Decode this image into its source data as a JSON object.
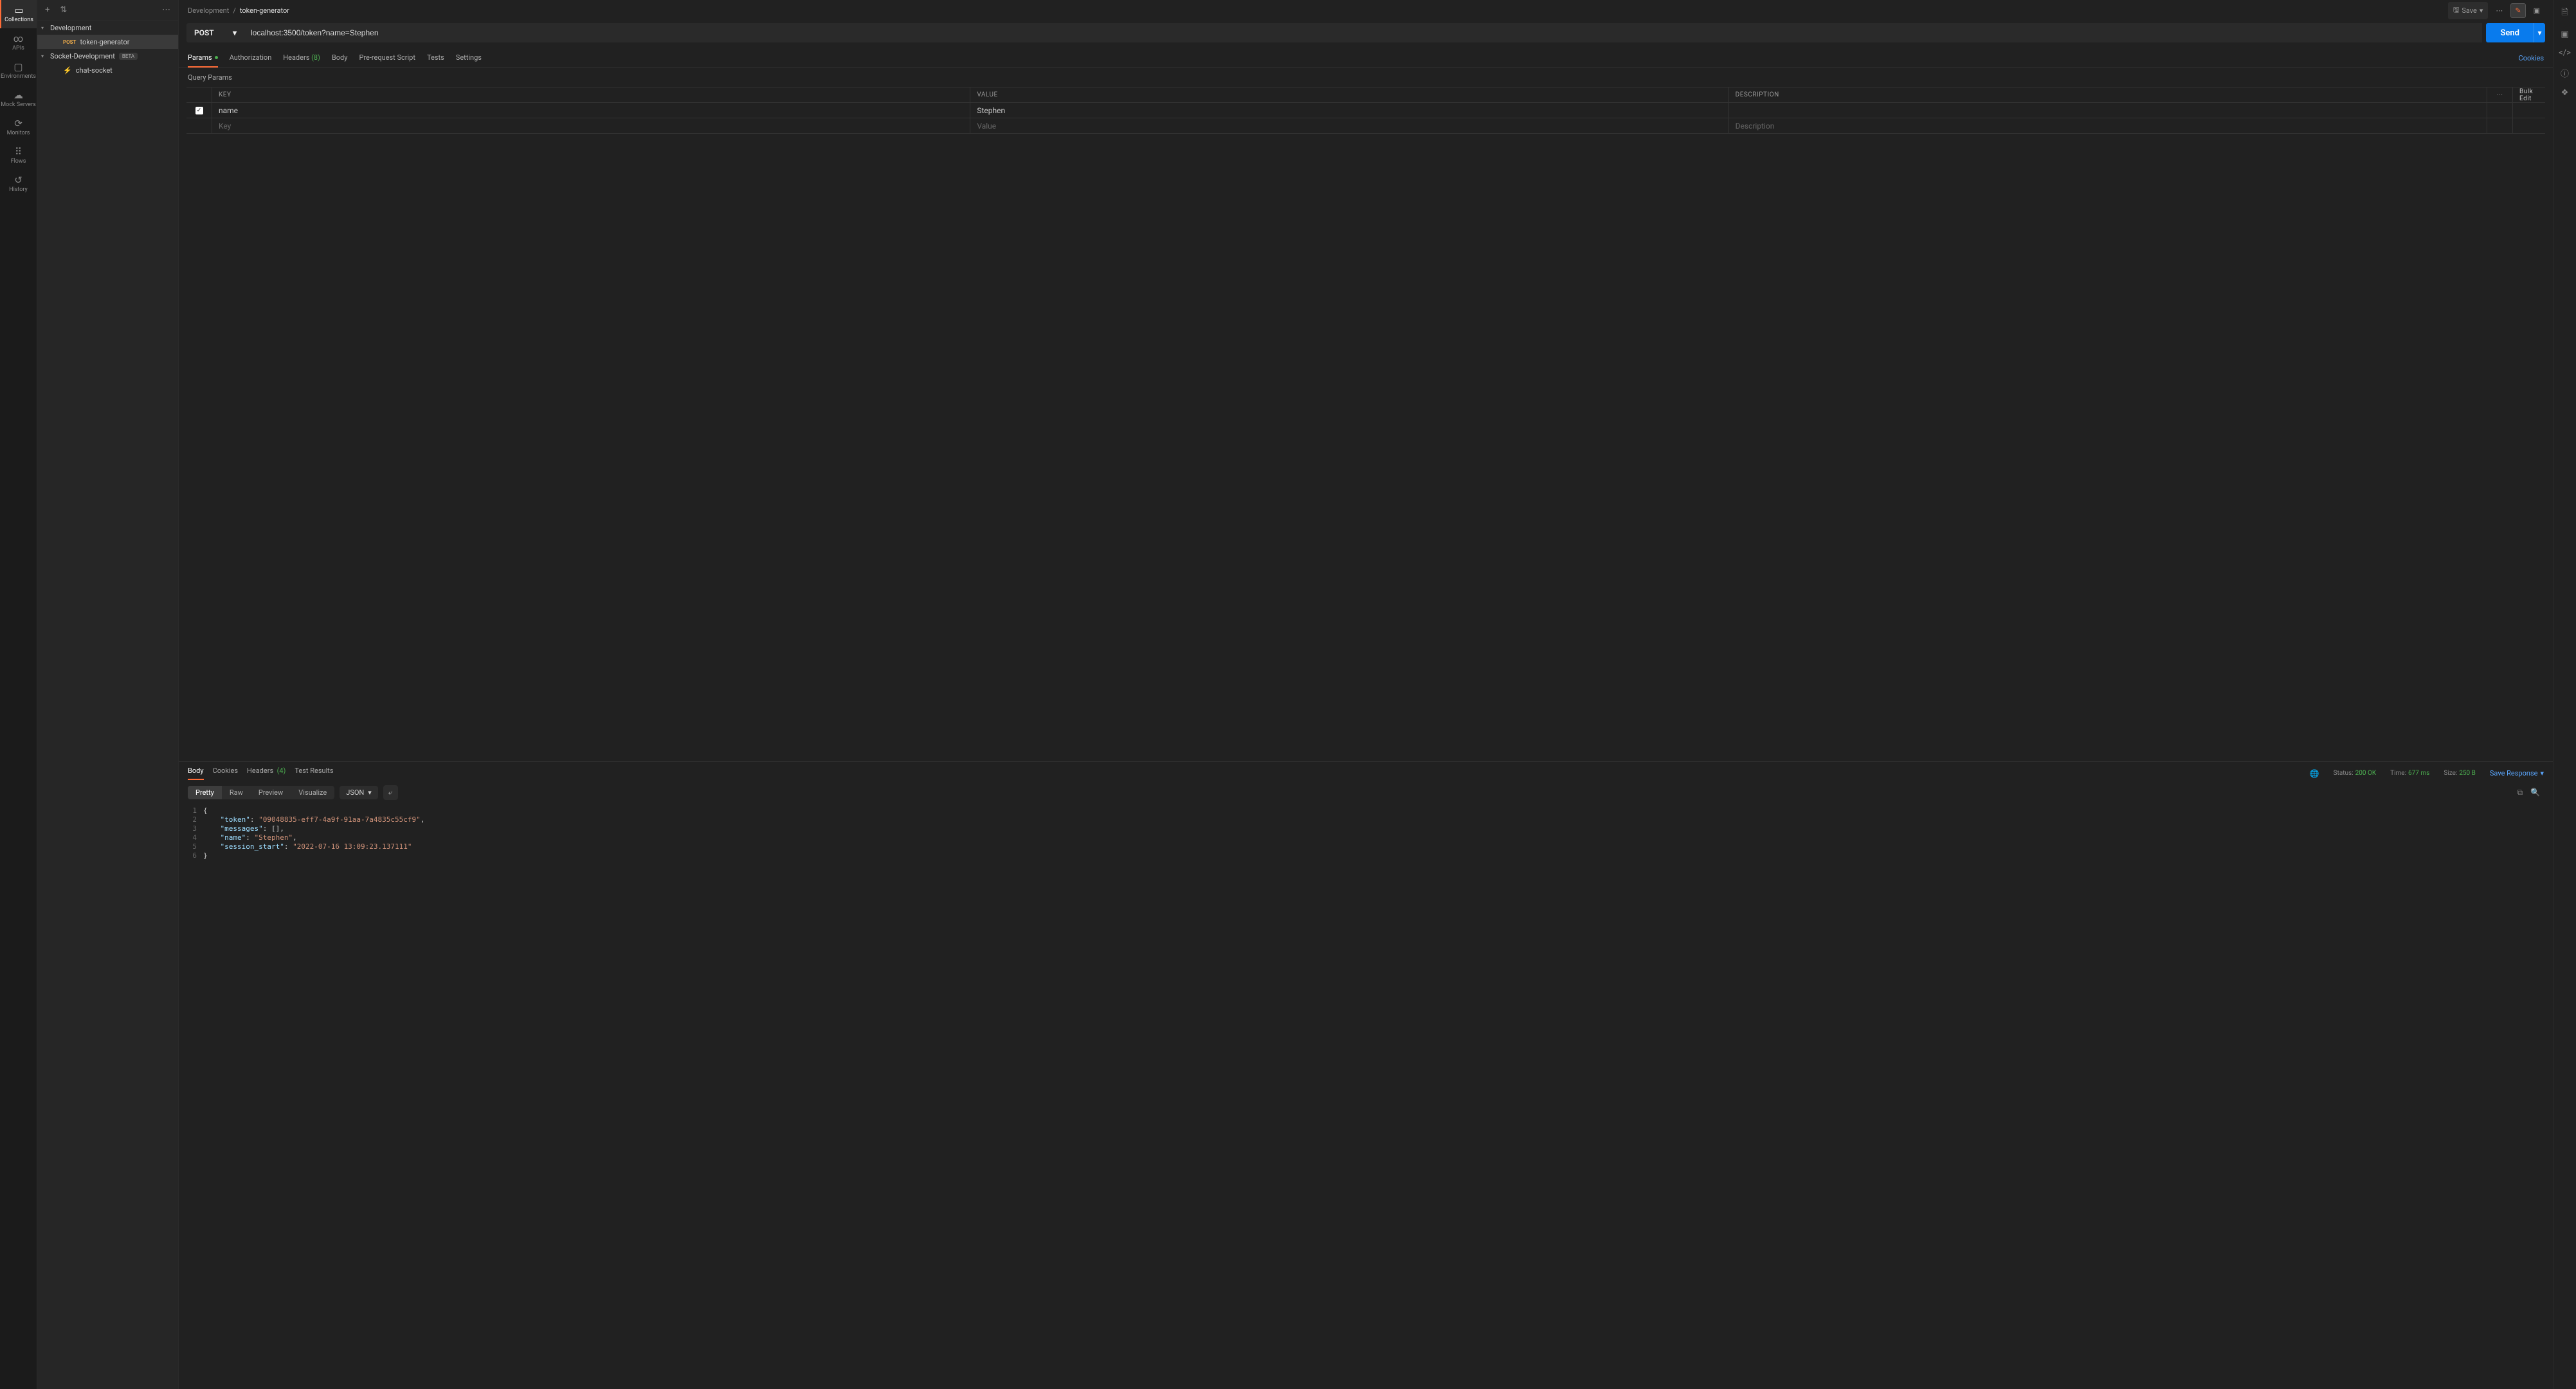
{
  "rail": {
    "items": [
      {
        "label": "Collections",
        "icon": "▭"
      },
      {
        "label": "APIs",
        "icon": "∞"
      },
      {
        "label": "Environments",
        "icon": "▢"
      },
      {
        "label": "Mock Servers",
        "icon": "☁"
      },
      {
        "label": "Monitors",
        "icon": "⟳"
      },
      {
        "label": "Flows",
        "icon": "⠿"
      },
      {
        "label": "History",
        "icon": "↺"
      }
    ]
  },
  "tree": {
    "collection": "Development",
    "request": {
      "method": "POST",
      "name": "token-generator"
    },
    "folder": {
      "name": "Socket-Development",
      "tag": "BETA"
    },
    "socket": "chat-socket"
  },
  "breadcrumb": {
    "parent": "Development",
    "sep": "/",
    "name": "token-generator"
  },
  "header_actions": {
    "save": "Save"
  },
  "url_bar": {
    "method": "POST",
    "url": "localhost:3500/token?name=Stephen",
    "send": "Send"
  },
  "req_tabs": {
    "params": "Params",
    "auth": "Authorization",
    "headers": "Headers",
    "headers_count": "(8)",
    "body": "Body",
    "prereq": "Pre-request Script",
    "tests": "Tests",
    "settings": "Settings",
    "cookies": "Cookies"
  },
  "params": {
    "title": "Query Params",
    "cols": {
      "key": "KEY",
      "value": "VALUE",
      "desc": "DESCRIPTION",
      "bulk": "Bulk Edit"
    },
    "rows": [
      {
        "key": "name",
        "value": "Stephen",
        "desc": ""
      }
    ],
    "placeholders": {
      "key": "Key",
      "value": "Value",
      "desc": "Description"
    }
  },
  "resp_tabs": {
    "body": "Body",
    "cookies": "Cookies",
    "headers": "Headers",
    "headers_count": "(4)",
    "tests": "Test Results"
  },
  "resp_meta": {
    "status_label": "Status:",
    "status_val": "200 OK",
    "time_label": "Time:",
    "time_val": "677 ms",
    "size_label": "Size:",
    "size_val": "250 B",
    "save": "Save Response"
  },
  "resp_views": {
    "pretty": "Pretty",
    "raw": "Raw",
    "preview": "Preview",
    "visualize": "Visualize",
    "lang": "JSON"
  },
  "response_body": {
    "token": "09048835-eff7-4a9f-91aa-7a4835c55cf9",
    "messages": [],
    "name": "Stephen",
    "session_start": "2022-07-16 13:09:23.137111"
  }
}
